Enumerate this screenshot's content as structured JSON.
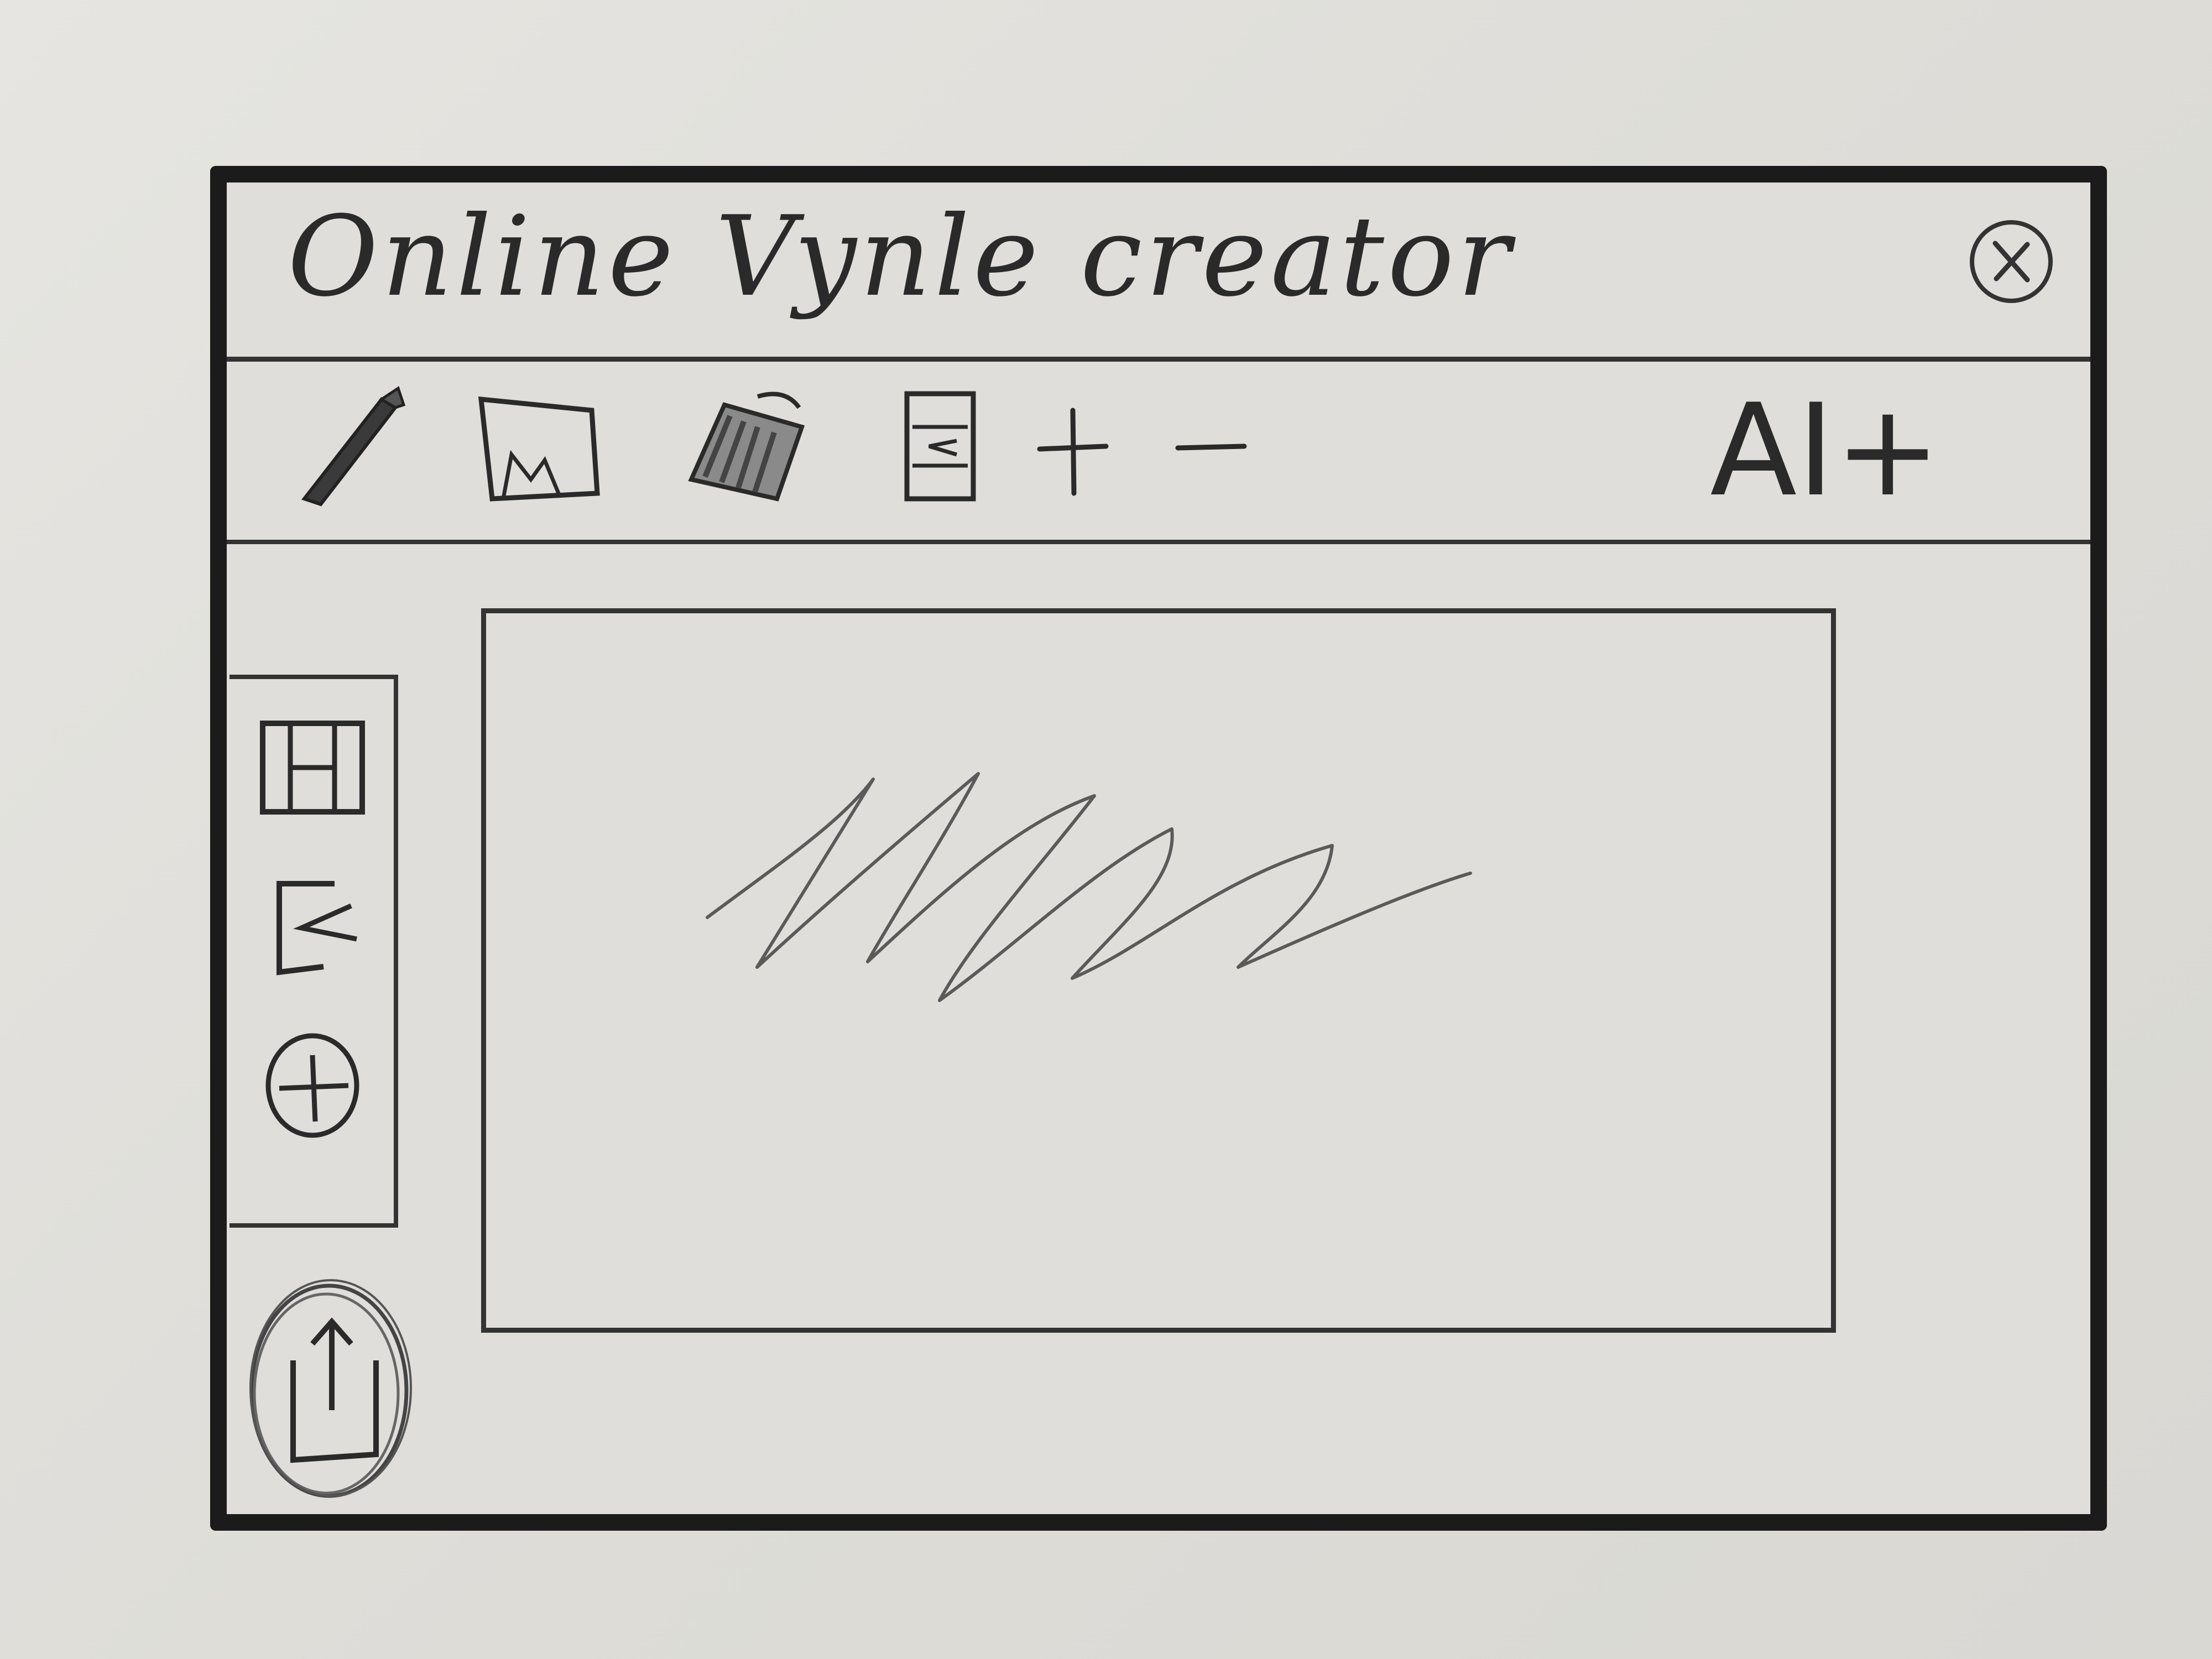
{
  "window": {
    "title": "Online Vynle creator"
  },
  "toolbar": {
    "items": [
      {
        "icon": "pencil-icon"
      },
      {
        "icon": "image-icon"
      },
      {
        "icon": "paint-bucket-icon"
      },
      {
        "icon": "document-import-icon"
      },
      {
        "icon": "zoom-in-icon",
        "label": "+"
      },
      {
        "icon": "zoom-out-icon",
        "label": "−"
      }
    ],
    "ai_label": "AI+"
  },
  "sidebar": {
    "items": [
      {
        "icon": "layout-icon"
      },
      {
        "icon": "import-icon"
      },
      {
        "icon": "add-icon"
      }
    ]
  },
  "upload": {
    "icon": "upload-icon"
  },
  "canvas": {
    "content": "scribble-drawing"
  }
}
